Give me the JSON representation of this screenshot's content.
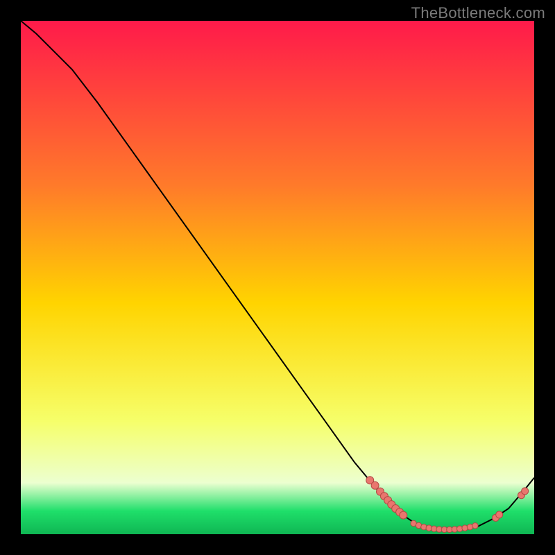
{
  "watermark": "TheBottleneck.com",
  "colors": {
    "bg_black": "#000000",
    "grad_top": "#ff1a4a",
    "grad_mid_upper": "#ff7a2a",
    "grad_mid": "#ffd400",
    "grad_mid_lower": "#f6ff6a",
    "grad_band_light": "#ecffd0",
    "grad_green": "#1fdf6a",
    "grad_green_deep": "#0fb653",
    "curve": "#000000",
    "marker_fill": "#e9766e",
    "marker_stroke": "#b24a44",
    "watermark_text": "#7b7b7b"
  },
  "chart_data": {
    "type": "line",
    "title": "",
    "xlabel": "",
    "ylabel": "",
    "xlim": [
      0,
      100
    ],
    "ylim": [
      0,
      100
    ],
    "curve": [
      [
        0,
        100
      ],
      [
        3,
        97.5
      ],
      [
        7,
        93.5
      ],
      [
        10,
        90.5
      ],
      [
        15,
        84
      ],
      [
        20,
        77
      ],
      [
        25,
        70
      ],
      [
        30,
        63
      ],
      [
        35,
        56
      ],
      [
        40,
        49
      ],
      [
        45,
        42
      ],
      [
        50,
        35
      ],
      [
        55,
        28
      ],
      [
        60,
        21
      ],
      [
        65,
        14
      ],
      [
        70,
        8
      ],
      [
        74,
        4
      ],
      [
        77,
        2
      ],
      [
        80,
        1
      ],
      [
        83,
        0.8
      ],
      [
        86,
        1
      ],
      [
        89,
        1.5
      ],
      [
        92,
        3
      ],
      [
        95,
        5
      ],
      [
        98,
        8.5
      ],
      [
        100,
        11
      ]
    ],
    "markers_left_trail": [
      [
        68,
        10.5
      ],
      [
        69,
        9.5
      ],
      [
        70,
        8.3
      ],
      [
        70.8,
        7.4
      ],
      [
        71.5,
        6.6
      ],
      [
        72.2,
        5.8
      ],
      [
        73,
        5.0
      ],
      [
        73.8,
        4.3
      ],
      [
        74.5,
        3.7
      ]
    ],
    "markers_bottom_band": [
      [
        76.5,
        2.1
      ],
      [
        77.5,
        1.7
      ],
      [
        78.5,
        1.4
      ],
      [
        79.5,
        1.2
      ],
      [
        80.5,
        1.05
      ],
      [
        81.5,
        0.95
      ],
      [
        82.5,
        0.9
      ],
      [
        83.5,
        0.9
      ],
      [
        84.5,
        0.95
      ],
      [
        85.5,
        1.05
      ],
      [
        86.5,
        1.2
      ],
      [
        87.5,
        1.4
      ],
      [
        88.5,
        1.65
      ]
    ],
    "markers_right_trail": [
      [
        92.5,
        3.2
      ],
      [
        93.2,
        3.8
      ],
      [
        97.5,
        7.6
      ],
      [
        98.2,
        8.4
      ]
    ],
    "marker_radius_left": 5.5,
    "marker_radius_bottom": 4.2,
    "marker_radius_right": 5.0
  }
}
